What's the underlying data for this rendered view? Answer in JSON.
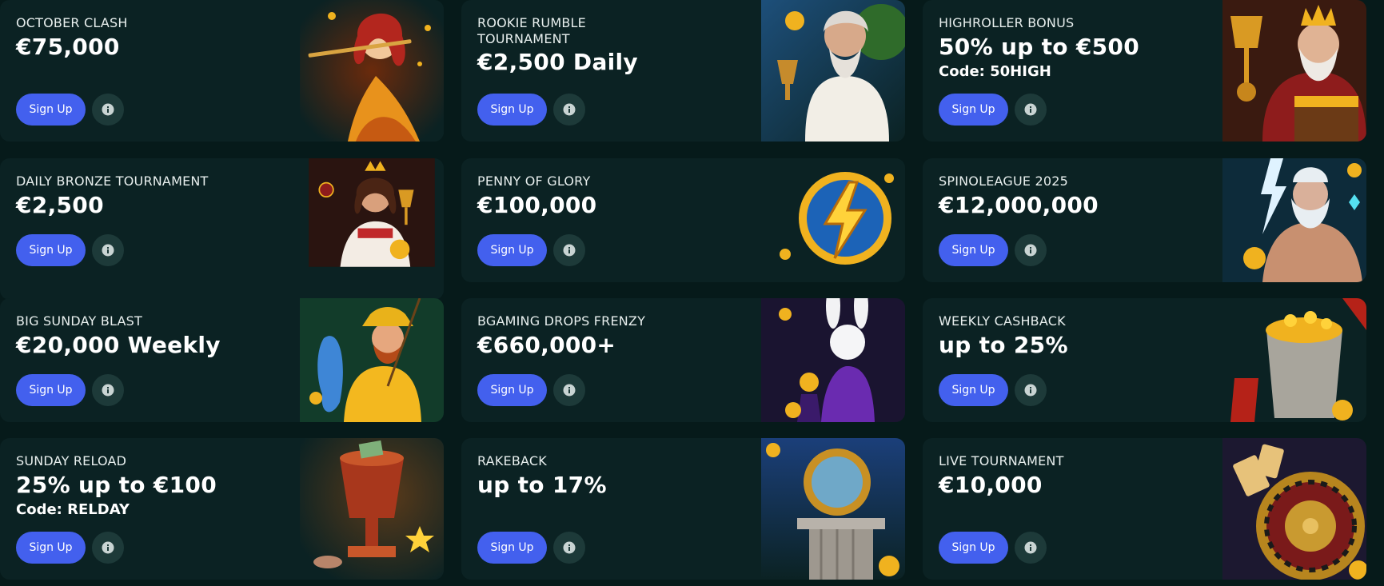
{
  "signup_label": "Sign Up",
  "cards": [
    {
      "title": "OCTOBER CLASH",
      "amount": "€75,000",
      "code": "",
      "art": "autumn-fairy-flute-art"
    },
    {
      "title": "ROOKIE RUMBLE TOURNAMENT",
      "amount": "€2,500 Daily",
      "code": "",
      "art": "zeus-chalice-art"
    },
    {
      "title": "HIGHROLLER BONUS",
      "amount": "50% up to €500",
      "code": "Code: 50HIGH",
      "art": "king-treasure-chest-art"
    },
    {
      "title": "DAILY BRONZE TOURNAMENT",
      "amount": "€2,500",
      "code": "",
      "art": "goddess-chalice-art"
    },
    {
      "title": "PENNY OF GLORY",
      "amount": "€100,000",
      "code": "",
      "art": "lightning-coin-art"
    },
    {
      "title": "SPINOLEAGUE 2025",
      "amount": "€12,000,000",
      "code": "",
      "art": "zeus-lightning-art"
    },
    {
      "title": "BIG SUNDAY BLAST",
      "amount": "€20,000 Weekly",
      "code": "",
      "art": "fisherman-art"
    },
    {
      "title": "BGAMING DROPS FRENZY",
      "amount": "€660,000+",
      "code": "",
      "art": "magic-rabbit-art"
    },
    {
      "title": "WEEKLY CASHBACK",
      "amount": "up to 25%",
      "code": "",
      "art": "cashback-pot-art"
    },
    {
      "title": "SUNDAY RELOAD",
      "amount": "25% up to €100",
      "code": "Code: RELDAY",
      "art": "money-trophy-art"
    },
    {
      "title": "RAKEBACK",
      "amount": "up to 17%",
      "code": "",
      "art": "rakeback-pillar-art"
    },
    {
      "title": "LIVE TOURNAMENT",
      "amount": "€10,000",
      "code": "",
      "art": "roulette-wheel-art"
    }
  ],
  "colors": {
    "background": "#061a1a",
    "card": "#0b2223",
    "signup_button": "#4360ee",
    "info_button": "#1d3a39",
    "gold": "#f0b21f"
  }
}
